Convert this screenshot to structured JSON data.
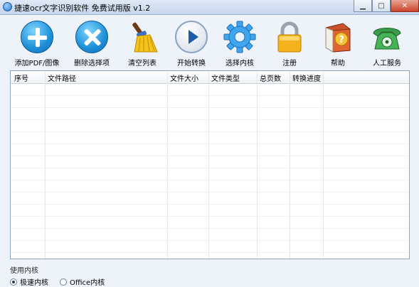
{
  "window": {
    "title": "捷速ocr文字识别软件 免费试用版 v1.2",
    "min_glyph": "▁",
    "max_glyph": "□",
    "close_glyph": "✕"
  },
  "toolbar": [
    {
      "label": "添加PDF/图像",
      "icon": "plus-circle-icon"
    },
    {
      "label": "删除选择项",
      "icon": "x-circle-icon"
    },
    {
      "label": "清空列表",
      "icon": "broom-icon"
    },
    {
      "label": "开始转换",
      "icon": "play-icon"
    },
    {
      "label": "选择内核",
      "icon": "gear-icon"
    },
    {
      "label": "注册",
      "icon": "lock-icon"
    },
    {
      "label": "帮助",
      "icon": "help-book-icon"
    },
    {
      "label": "人工服务",
      "icon": "phone-icon"
    }
  ],
  "table": {
    "columns": [
      "序号",
      "文件路径",
      "文件大小",
      "文件类型",
      "总页数",
      "转换进度"
    ],
    "rows": []
  },
  "kernel": {
    "title": "使用内核",
    "options": [
      {
        "label": "极速内核",
        "selected": true
      },
      {
        "label": "Office内核",
        "selected": false
      }
    ]
  },
  "colors": {
    "accent_blue": "#1f8fd8",
    "title_bar": "#c6d6ec",
    "window_bg": "#eef3fa",
    "close_red": "#c9452a"
  }
}
